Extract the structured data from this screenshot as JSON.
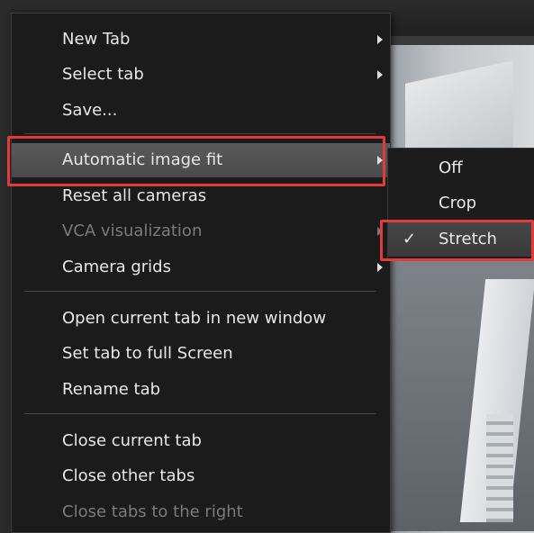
{
  "menu": {
    "items": [
      {
        "label": "New Tab"
      },
      {
        "label": "Select tab"
      },
      {
        "label": "Save..."
      },
      {
        "label": "Automatic image fit"
      },
      {
        "label": "Reset all cameras"
      },
      {
        "label": "VCA visualization"
      },
      {
        "label": "Camera grids"
      },
      {
        "label": "Open current tab in new window"
      },
      {
        "label": "Set tab to full Screen"
      },
      {
        "label": "Rename tab"
      },
      {
        "label": "Close current tab"
      },
      {
        "label": "Close other tabs"
      },
      {
        "label": "Close tabs to the right"
      }
    ]
  },
  "submenu": {
    "items": [
      {
        "label": "Off"
      },
      {
        "label": "Crop"
      },
      {
        "label": "Stretch",
        "check": "✓"
      }
    ]
  },
  "colors": {
    "annotation": "#e23b3b",
    "menu_bg": "#1b1b1b",
    "highlight": "#555555",
    "disabled_text": "#7b7b7b"
  }
}
